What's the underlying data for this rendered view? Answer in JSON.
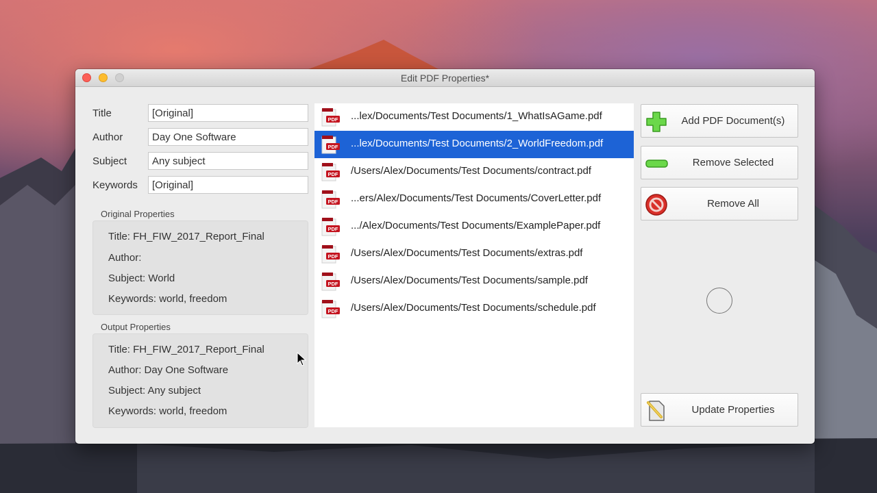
{
  "window": {
    "title": "Edit PDF Properties*"
  },
  "fields": [
    {
      "label": "Title",
      "value": "[Original]"
    },
    {
      "label": "Author",
      "value": "Day One Software"
    },
    {
      "label": "Subject",
      "value": "Any subject"
    },
    {
      "label": "Keywords",
      "value": "[Original]"
    }
  ],
  "original_properties": {
    "heading": "Original Properties",
    "lines": [
      "Title: FH_FIW_2017_Report_Final",
      "Author:",
      "Subject: World",
      "Keywords: world, freedom"
    ]
  },
  "output_properties": {
    "heading": "Output Properties",
    "lines": [
      "Title: FH_FIW_2017_Report_Final",
      "Author: Day One Software",
      "Subject: Any subject",
      "Keywords: world, freedom"
    ]
  },
  "files": {
    "icon": "pdf-icon",
    "icon_text": "PDF",
    "selected_index": 1,
    "items": [
      "...lex/Documents/Test Documents/1_WhatIsAGame.pdf",
      "...lex/Documents/Test Documents/2_WorldFreedom.pdf",
      "/Users/Alex/Documents/Test Documents/contract.pdf",
      "...ers/Alex/Documents/Test Documents/CoverLetter.pdf",
      ".../Alex/Documents/Test Documents/ExamplePaper.pdf",
      "/Users/Alex/Documents/Test Documents/extras.pdf",
      "/Users/Alex/Documents/Test Documents/sample.pdf",
      "/Users/Alex/Documents/Test Documents/schedule.pdf"
    ]
  },
  "buttons": {
    "add": {
      "label": "Add PDF Document(s)",
      "icon": "plus-icon"
    },
    "remove_selected": {
      "label": "Remove Selected",
      "icon": "minus-icon"
    },
    "remove_all": {
      "label": "Remove All",
      "icon": "no-entry-icon"
    },
    "update": {
      "label": "Update Properties",
      "icon": "edit-document-icon"
    }
  },
  "colors": {
    "selection": "#1d63d6",
    "pdf_red": "#b0121b",
    "plus_green": "#5ccf3a",
    "remove_all_red": "#d9302a"
  }
}
